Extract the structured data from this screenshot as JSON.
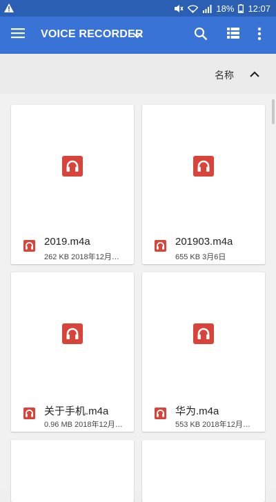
{
  "status_bar": {
    "battery_percent": "18%",
    "time": "12:07",
    "icons": [
      "warning-icon",
      "mute-icon",
      "wifi-icon",
      "signal-icon",
      "battery-icon"
    ]
  },
  "app_bar": {
    "title": "VOICE RECORDER",
    "icons": [
      "menu-icon",
      "chevron-down-icon",
      "search-icon",
      "list-view-icon",
      "more-vert-icon"
    ]
  },
  "sort_bar": {
    "label": "名称",
    "direction_icon": "chevron-up-icon"
  },
  "files": [
    {
      "name": "2019.m4a",
      "meta": "262 KB 2018年12月…"
    },
    {
      "name": "201903.m4a",
      "meta": "655 KB 3月6日"
    },
    {
      "name": "关于手机.m4a",
      "meta": "0.96 MB 2018年12月…"
    },
    {
      "name": "华为.m4a",
      "meta": "553 KB 2018年12月…"
    }
  ],
  "colors": {
    "status_bar": "#2b5fb4",
    "app_bar": "#3a73d6",
    "file_icon": "#d9443a"
  }
}
